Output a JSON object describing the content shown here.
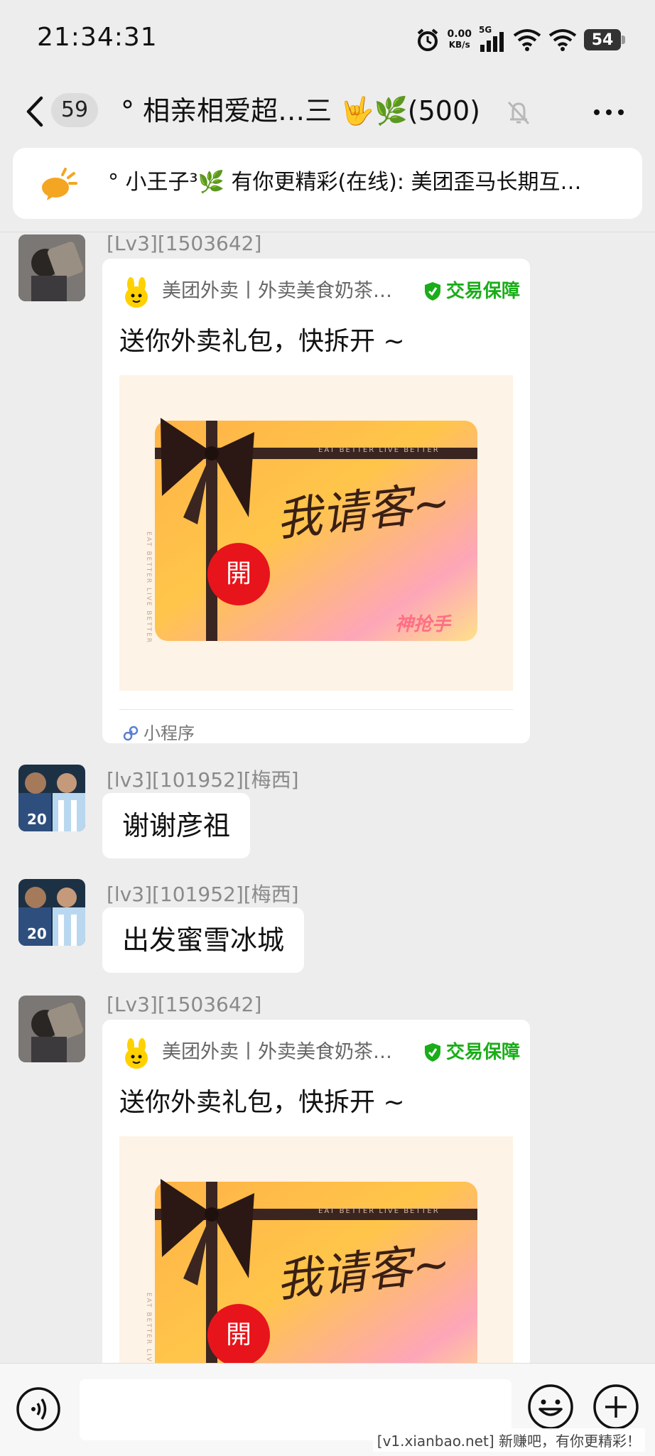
{
  "status_bar": {
    "time": "21:34:31",
    "net_speed_value": "0.00",
    "net_speed_unit": "KB/s",
    "network": "5G",
    "battery": "54"
  },
  "header": {
    "unread_count": "59",
    "title": "° 相亲相爱超…三 🤟🌿(500)"
  },
  "notice": {
    "text": "° 小王子³🌿 有你更精彩(在线): 美团歪马长期互…"
  },
  "messages": [
    {
      "sender": "[Lv3][1503642]",
      "card": {
        "app_name": "美团外卖丨外卖美食奶茶…",
        "guarantee": "交易保障",
        "title": "送你外卖礼包，快拆开 ~",
        "image_slogan": "我请客~",
        "image_banner": "EAT BETTER LIVE BETTER",
        "image_ribbon": "EAT BETTER LIVE BETTER",
        "image_open": "開",
        "image_stamp": "神抢手",
        "footer": "小程序"
      }
    },
    {
      "sender": "[lv3][101952][梅西]",
      "text": "谢谢彦祖"
    },
    {
      "sender": "[lv3][101952][梅西]",
      "text": "出发蜜雪冰城"
    },
    {
      "sender": "[Lv3][1503642]",
      "card": {
        "app_name": "美团外卖丨外卖美食奶茶…",
        "guarantee": "交易保障",
        "title": "送你外卖礼包，快拆开 ~",
        "image_slogan": "我请客~",
        "image_banner": "EAT BETTER LIVE BETTER",
        "image_ribbon": "EAT BETTER LIVE BETTER",
        "image_open": "開"
      }
    }
  ],
  "input": {
    "placeholder": ""
  },
  "watermark": "[v1.xianbao.net] 新赚吧，有你更精彩！",
  "colors": {
    "background": "#ededed",
    "guarantee_green": "#1aad19",
    "open_red": "#e8141b",
    "meituan_yellow": "#ffd100"
  }
}
